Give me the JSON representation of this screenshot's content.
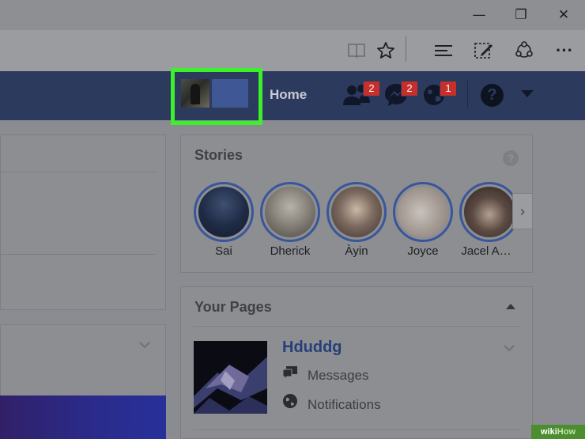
{
  "window": {
    "minimize_glyph": "—",
    "restore_glyph": "❐",
    "close_glyph": "✕"
  },
  "toolbar": {
    "icons": [
      "reading-view-icon",
      "favorites-star-icon",
      "hub-icon",
      "web-note-icon",
      "share-icon",
      "more-icon"
    ],
    "more_glyph": "···"
  },
  "fb_header": {
    "home_label": "Home",
    "friend_requests_count": "2",
    "messages_count": "2",
    "notifications_count": "1",
    "help_glyph": "?",
    "highlight_color": "#3cf02a",
    "bar_color": "#2c3a5e"
  },
  "stories": {
    "title": "Stories",
    "help_glyph": "?",
    "next_glyph": "›",
    "items": [
      {
        "name": "Sai"
      },
      {
        "name": "Dherick"
      },
      {
        "name": "Àyin"
      },
      {
        "name": "Joyce"
      },
      {
        "name": "Jacel A…"
      }
    ]
  },
  "your_pages": {
    "title": "Your Pages",
    "page_name": "Hduddg",
    "messages_label": "Messages",
    "notifications_label": "Notifications"
  },
  "watermark": {
    "prefix": "wiki",
    "suffix": "How"
  }
}
